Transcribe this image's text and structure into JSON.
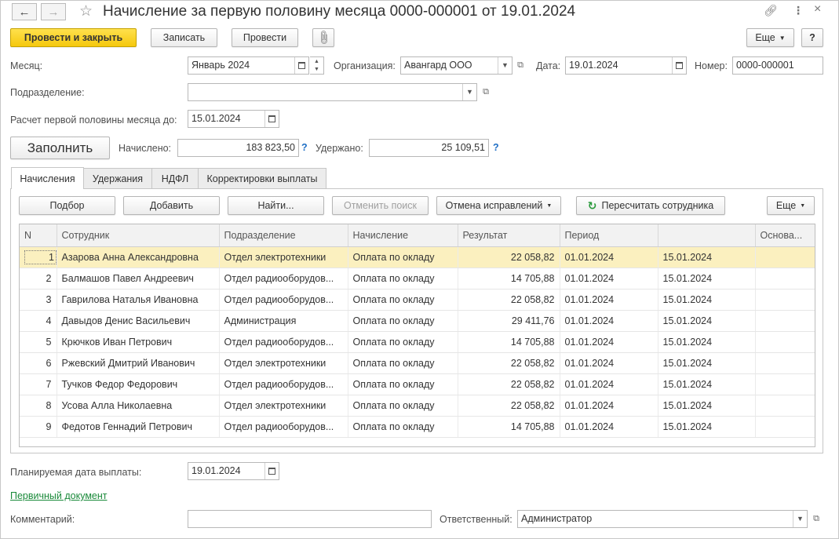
{
  "title": "Начисление за первую половину месяца 0000-000001 от 19.01.2024",
  "toolbar": {
    "post_close": "Провести и закрыть",
    "save": "Записать",
    "post": "Провести",
    "more": "Еще",
    "help": "?"
  },
  "fields": {
    "month_label": "Месяц:",
    "month_value": "Январь 2024",
    "org_label": "Организация:",
    "org_value": "Авангард ООО",
    "date_label": "Дата:",
    "date_value": "19.01.2024",
    "number_label": "Номер:",
    "number_value": "0000-000001",
    "division_label": "Подразделение:",
    "division_value": "",
    "calc_until_label": "Расчет первой половины месяца до:",
    "calc_until_value": "15.01.2024",
    "fill_button": "Заполнить",
    "accrued_label": "Начислено:",
    "accrued_value": "183 823,50",
    "withheld_label": "Удержано:",
    "withheld_value": "25 109,51",
    "q": "?"
  },
  "tabs": [
    {
      "label": "Начисления",
      "active": true
    },
    {
      "label": "Удержания"
    },
    {
      "label": "НДФЛ"
    },
    {
      "label": "Корректировки выплаты"
    }
  ],
  "table_toolbar": {
    "select": "Подбор",
    "add": "Добавить",
    "find": "Найти...",
    "cancel_search": "Отменить поиск",
    "cancel_fixes": "Отмена исправлений",
    "recalc": "Пересчитать сотрудника",
    "more": "Еще"
  },
  "table": {
    "headers": [
      "N",
      "Сотрудник",
      "Подразделение",
      "Начисление",
      "Результат",
      "Период",
      "",
      "Основа..."
    ],
    "rows": [
      {
        "n": "1",
        "employee": "Азарова Анна Александровна",
        "division": "Отдел электротехники",
        "accrual": "Оплата по окладу",
        "result": "22 058,82",
        "from": "01.01.2024",
        "to": "15.01.2024"
      },
      {
        "n": "2",
        "employee": "Балмашов Павел Андреевич",
        "division": "Отдел радиооборудов...",
        "accrual": "Оплата по окладу",
        "result": "14 705,88",
        "from": "01.01.2024",
        "to": "15.01.2024"
      },
      {
        "n": "3",
        "employee": "Гаврилова Наталья Ивановна",
        "division": "Отдел радиооборудов...",
        "accrual": "Оплата по окладу",
        "result": "22 058,82",
        "from": "01.01.2024",
        "to": "15.01.2024"
      },
      {
        "n": "4",
        "employee": "Давыдов Денис Васильевич",
        "division": "Администрация",
        "accrual": "Оплата по окладу",
        "result": "29 411,76",
        "from": "01.01.2024",
        "to": "15.01.2024"
      },
      {
        "n": "5",
        "employee": "Крючков Иван Петрович",
        "division": "Отдел радиооборудов...",
        "accrual": "Оплата по окладу",
        "result": "14 705,88",
        "from": "01.01.2024",
        "to": "15.01.2024"
      },
      {
        "n": "6",
        "employee": "Ржевский Дмитрий Иванович",
        "division": "Отдел электротехники",
        "accrual": "Оплата по окладу",
        "result": "22 058,82",
        "from": "01.01.2024",
        "to": "15.01.2024"
      },
      {
        "n": "7",
        "employee": "Тучков Федор Федорович",
        "division": "Отдел радиооборудов...",
        "accrual": "Оплата по окладу",
        "result": "22 058,82",
        "from": "01.01.2024",
        "to": "15.01.2024"
      },
      {
        "n": "8",
        "employee": "Усова Алла Николаевна",
        "division": "Отдел электротехники",
        "accrual": "Оплата по окладу",
        "result": "22 058,82",
        "from": "01.01.2024",
        "to": "15.01.2024"
      },
      {
        "n": "9",
        "employee": "Федотов Геннадий Петрович",
        "division": "Отдел радиооборудов...",
        "accrual": "Оплата по окладу",
        "result": "14 705,88",
        "from": "01.01.2024",
        "to": "15.01.2024"
      }
    ]
  },
  "footer": {
    "pay_date_label": "Планируемая дата выплаты:",
    "pay_date_value": "19.01.2024",
    "primary_doc_link": "Первичный документ",
    "comment_label": "Комментарий:",
    "comment_value": "",
    "responsible_label": "Ответственный:",
    "responsible_value": "Администратор"
  },
  "colors": {
    "primary_button": "#f5c80e",
    "selected_row": "#fbf0bf",
    "link": "#1a8a3a",
    "help": "#1f6fc5"
  }
}
